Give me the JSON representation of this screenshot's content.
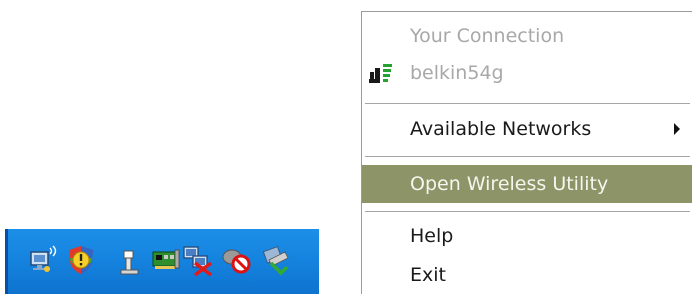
{
  "tray": {
    "icons": [
      {
        "name": "network-signal-icon"
      },
      {
        "name": "security-shield-icon"
      },
      {
        "name": "usb-device-icon"
      },
      {
        "name": "network-card-icon"
      },
      {
        "name": "network-disconnected-icon"
      },
      {
        "name": "no-connection-icon"
      },
      {
        "name": "safely-remove-hardware-icon"
      }
    ]
  },
  "menu": {
    "your_connection": "Your Connection",
    "network_name": "belkin54g",
    "available_networks": "Available Networks",
    "open_utility": "Open Wireless Utility",
    "help": "Help",
    "exit": "Exit"
  },
  "colors": {
    "highlight": "#8c9468",
    "signal_green": "#26a233",
    "taskbar_blue": "#1584df"
  }
}
